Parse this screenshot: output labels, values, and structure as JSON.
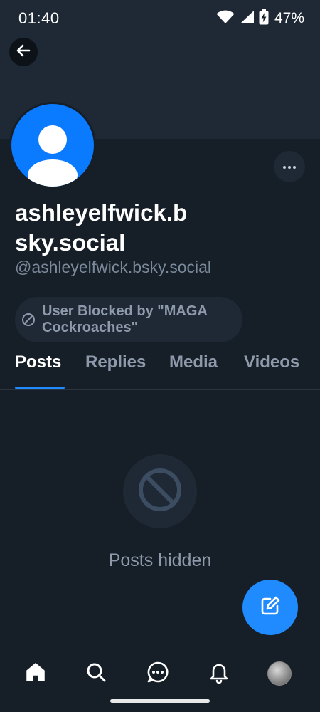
{
  "status_bar": {
    "time": "01:40",
    "battery_percent": "47%",
    "icons": [
      "wifi-icon",
      "signal-icon",
      "battery-charging-icon"
    ]
  },
  "profile": {
    "display_name": "ashleyelfwick.bsky.social",
    "handle": "@ashleyelfwick.bsky.social",
    "blocked_label": "User Blocked by \"MAGA Cockroaches\""
  },
  "tabs": [
    {
      "label": "Posts",
      "active": true
    },
    {
      "label": "Replies",
      "active": false
    },
    {
      "label": "Media",
      "active": false
    },
    {
      "label": "Videos",
      "active": false
    }
  ],
  "feed": {
    "empty_message": "Posts hidden",
    "empty_icon": "no-entry-icon"
  },
  "bottom_nav": [
    "home-icon",
    "search-icon",
    "chat-icon",
    "bell-icon",
    "profile-avatar"
  ],
  "colors": {
    "background": "#161e27",
    "banner": "#1e2935",
    "accent": "#208bfe",
    "avatar_blue": "#0a7aff",
    "muted_text": "#8e9aab"
  }
}
